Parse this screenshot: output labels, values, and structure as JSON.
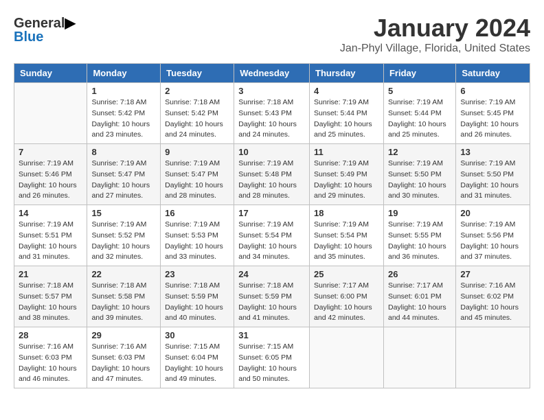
{
  "logo": {
    "general": "General",
    "blue": "Blue"
  },
  "header": {
    "title": "January 2024",
    "subtitle": "Jan-Phyl Village, Florida, United States"
  },
  "days_of_week": [
    "Sunday",
    "Monday",
    "Tuesday",
    "Wednesday",
    "Thursday",
    "Friday",
    "Saturday"
  ],
  "weeks": [
    [
      {
        "day": "",
        "sunrise": "",
        "sunset": "",
        "daylight": ""
      },
      {
        "day": "1",
        "sunrise": "Sunrise: 7:18 AM",
        "sunset": "Sunset: 5:42 PM",
        "daylight": "Daylight: 10 hours and 23 minutes."
      },
      {
        "day": "2",
        "sunrise": "Sunrise: 7:18 AM",
        "sunset": "Sunset: 5:42 PM",
        "daylight": "Daylight: 10 hours and 24 minutes."
      },
      {
        "day": "3",
        "sunrise": "Sunrise: 7:18 AM",
        "sunset": "Sunset: 5:43 PM",
        "daylight": "Daylight: 10 hours and 24 minutes."
      },
      {
        "day": "4",
        "sunrise": "Sunrise: 7:19 AM",
        "sunset": "Sunset: 5:44 PM",
        "daylight": "Daylight: 10 hours and 25 minutes."
      },
      {
        "day": "5",
        "sunrise": "Sunrise: 7:19 AM",
        "sunset": "Sunset: 5:44 PM",
        "daylight": "Daylight: 10 hours and 25 minutes."
      },
      {
        "day": "6",
        "sunrise": "Sunrise: 7:19 AM",
        "sunset": "Sunset: 5:45 PM",
        "daylight": "Daylight: 10 hours and 26 minutes."
      }
    ],
    [
      {
        "day": "7",
        "sunrise": "Sunrise: 7:19 AM",
        "sunset": "Sunset: 5:46 PM",
        "daylight": "Daylight: 10 hours and 26 minutes."
      },
      {
        "day": "8",
        "sunrise": "Sunrise: 7:19 AM",
        "sunset": "Sunset: 5:47 PM",
        "daylight": "Daylight: 10 hours and 27 minutes."
      },
      {
        "day": "9",
        "sunrise": "Sunrise: 7:19 AM",
        "sunset": "Sunset: 5:47 PM",
        "daylight": "Daylight: 10 hours and 28 minutes."
      },
      {
        "day": "10",
        "sunrise": "Sunrise: 7:19 AM",
        "sunset": "Sunset: 5:48 PM",
        "daylight": "Daylight: 10 hours and 28 minutes."
      },
      {
        "day": "11",
        "sunrise": "Sunrise: 7:19 AM",
        "sunset": "Sunset: 5:49 PM",
        "daylight": "Daylight: 10 hours and 29 minutes."
      },
      {
        "day": "12",
        "sunrise": "Sunrise: 7:19 AM",
        "sunset": "Sunset: 5:50 PM",
        "daylight": "Daylight: 10 hours and 30 minutes."
      },
      {
        "day": "13",
        "sunrise": "Sunrise: 7:19 AM",
        "sunset": "Sunset: 5:50 PM",
        "daylight": "Daylight: 10 hours and 31 minutes."
      }
    ],
    [
      {
        "day": "14",
        "sunrise": "Sunrise: 7:19 AM",
        "sunset": "Sunset: 5:51 PM",
        "daylight": "Daylight: 10 hours and 31 minutes."
      },
      {
        "day": "15",
        "sunrise": "Sunrise: 7:19 AM",
        "sunset": "Sunset: 5:52 PM",
        "daylight": "Daylight: 10 hours and 32 minutes."
      },
      {
        "day": "16",
        "sunrise": "Sunrise: 7:19 AM",
        "sunset": "Sunset: 5:53 PM",
        "daylight": "Daylight: 10 hours and 33 minutes."
      },
      {
        "day": "17",
        "sunrise": "Sunrise: 7:19 AM",
        "sunset": "Sunset: 5:54 PM",
        "daylight": "Daylight: 10 hours and 34 minutes."
      },
      {
        "day": "18",
        "sunrise": "Sunrise: 7:19 AM",
        "sunset": "Sunset: 5:54 PM",
        "daylight": "Daylight: 10 hours and 35 minutes."
      },
      {
        "day": "19",
        "sunrise": "Sunrise: 7:19 AM",
        "sunset": "Sunset: 5:55 PM",
        "daylight": "Daylight: 10 hours and 36 minutes."
      },
      {
        "day": "20",
        "sunrise": "Sunrise: 7:19 AM",
        "sunset": "Sunset: 5:56 PM",
        "daylight": "Daylight: 10 hours and 37 minutes."
      }
    ],
    [
      {
        "day": "21",
        "sunrise": "Sunrise: 7:18 AM",
        "sunset": "Sunset: 5:57 PM",
        "daylight": "Daylight: 10 hours and 38 minutes."
      },
      {
        "day": "22",
        "sunrise": "Sunrise: 7:18 AM",
        "sunset": "Sunset: 5:58 PM",
        "daylight": "Daylight: 10 hours and 39 minutes."
      },
      {
        "day": "23",
        "sunrise": "Sunrise: 7:18 AM",
        "sunset": "Sunset: 5:59 PM",
        "daylight": "Daylight: 10 hours and 40 minutes."
      },
      {
        "day": "24",
        "sunrise": "Sunrise: 7:18 AM",
        "sunset": "Sunset: 5:59 PM",
        "daylight": "Daylight: 10 hours and 41 minutes."
      },
      {
        "day": "25",
        "sunrise": "Sunrise: 7:17 AM",
        "sunset": "Sunset: 6:00 PM",
        "daylight": "Daylight: 10 hours and 42 minutes."
      },
      {
        "day": "26",
        "sunrise": "Sunrise: 7:17 AM",
        "sunset": "Sunset: 6:01 PM",
        "daylight": "Daylight: 10 hours and 44 minutes."
      },
      {
        "day": "27",
        "sunrise": "Sunrise: 7:16 AM",
        "sunset": "Sunset: 6:02 PM",
        "daylight": "Daylight: 10 hours and 45 minutes."
      }
    ],
    [
      {
        "day": "28",
        "sunrise": "Sunrise: 7:16 AM",
        "sunset": "Sunset: 6:03 PM",
        "daylight": "Daylight: 10 hours and 46 minutes."
      },
      {
        "day": "29",
        "sunrise": "Sunrise: 7:16 AM",
        "sunset": "Sunset: 6:03 PM",
        "daylight": "Daylight: 10 hours and 47 minutes."
      },
      {
        "day": "30",
        "sunrise": "Sunrise: 7:15 AM",
        "sunset": "Sunset: 6:04 PM",
        "daylight": "Daylight: 10 hours and 49 minutes."
      },
      {
        "day": "31",
        "sunrise": "Sunrise: 7:15 AM",
        "sunset": "Sunset: 6:05 PM",
        "daylight": "Daylight: 10 hours and 50 minutes."
      },
      {
        "day": "",
        "sunrise": "",
        "sunset": "",
        "daylight": ""
      },
      {
        "day": "",
        "sunrise": "",
        "sunset": "",
        "daylight": ""
      },
      {
        "day": "",
        "sunrise": "",
        "sunset": "",
        "daylight": ""
      }
    ]
  ]
}
